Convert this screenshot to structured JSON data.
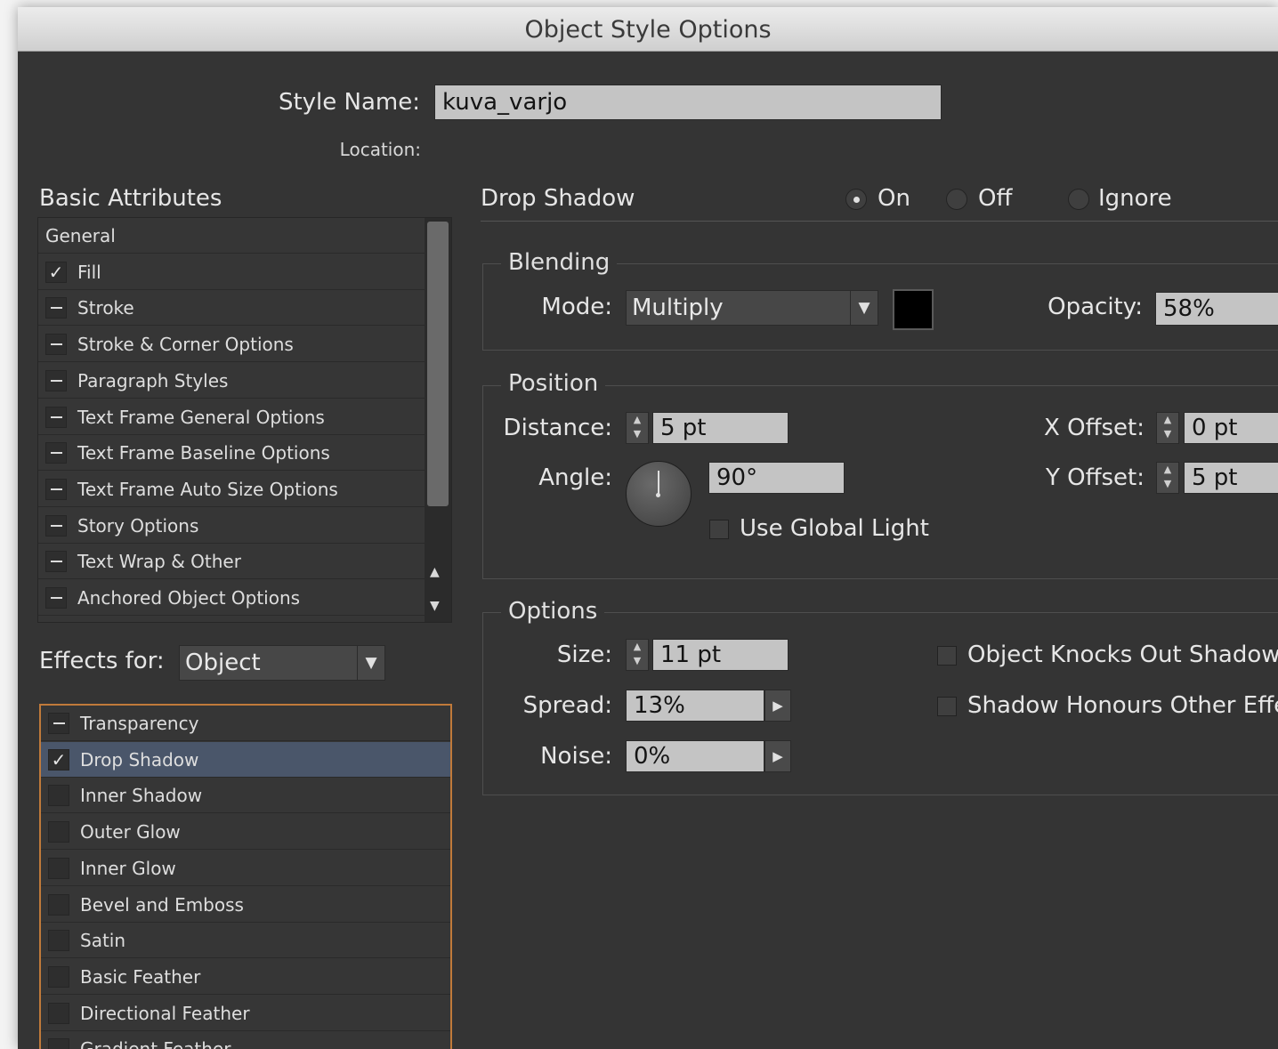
{
  "window": {
    "title": "Object Style Options"
  },
  "style_name": {
    "label": "Style Name:",
    "value": "kuva_varjo"
  },
  "location": {
    "label": "Location:"
  },
  "basic_attributes": {
    "heading": "Basic Attributes",
    "items": [
      {
        "label": "General",
        "state": "none"
      },
      {
        "label": "Fill",
        "state": "checked"
      },
      {
        "label": "Stroke",
        "state": "ignore"
      },
      {
        "label": "Stroke & Corner Options",
        "state": "ignore"
      },
      {
        "label": "Paragraph Styles",
        "state": "ignore"
      },
      {
        "label": "Text Frame General Options",
        "state": "ignore"
      },
      {
        "label": "Text Frame Baseline Options",
        "state": "ignore"
      },
      {
        "label": "Text Frame Auto Size Options",
        "state": "ignore"
      },
      {
        "label": "Story Options",
        "state": "ignore"
      },
      {
        "label": "Text Wrap & Other",
        "state": "ignore"
      },
      {
        "label": "Anchored Object Options",
        "state": "ignore"
      }
    ]
  },
  "effects_for": {
    "label": "Effects for:",
    "value": "Object"
  },
  "effects_list": {
    "items": [
      {
        "label": "Transparency",
        "state": "ignore",
        "selected": false
      },
      {
        "label": "Drop Shadow",
        "state": "checked",
        "selected": true
      },
      {
        "label": "Inner Shadow",
        "state": "unchecked",
        "selected": false
      },
      {
        "label": "Outer Glow",
        "state": "unchecked",
        "selected": false
      },
      {
        "label": "Inner Glow",
        "state": "unchecked",
        "selected": false
      },
      {
        "label": "Bevel and Emboss",
        "state": "unchecked",
        "selected": false
      },
      {
        "label": "Satin",
        "state": "unchecked",
        "selected": false
      },
      {
        "label": "Basic Feather",
        "state": "unchecked",
        "selected": false
      },
      {
        "label": "Directional Feather",
        "state": "unchecked",
        "selected": false
      },
      {
        "label": "Gradient Feather",
        "state": "unchecked",
        "selected": false
      }
    ]
  },
  "drop_shadow": {
    "heading": "Drop Shadow",
    "radios": {
      "on": "On",
      "off": "Off",
      "ignore": "Ignore",
      "selected": "on"
    },
    "blending": {
      "title": "Blending",
      "mode_label": "Mode:",
      "mode_value": "Multiply",
      "color": "#000000",
      "opacity_label": "Opacity:",
      "opacity_value": "58%"
    },
    "position": {
      "title": "Position",
      "distance_label": "Distance:",
      "distance_value": "5 pt",
      "angle_label": "Angle:",
      "angle_value": "90°",
      "use_global_light": "Use Global Light",
      "x_offset_label": "X Offset:",
      "x_offset_value": "0 pt",
      "y_offset_label": "Y Offset:",
      "y_offset_value": "5 pt"
    },
    "options": {
      "title": "Options",
      "size_label": "Size:",
      "size_value": "11 pt",
      "spread_label": "Spread:",
      "spread_value": "13%",
      "noise_label": "Noise:",
      "noise_value": "0%",
      "knocks_out": "Object Knocks Out Shadow",
      "honours_effects": "Shadow Honours Other Effects"
    }
  },
  "colors": {
    "selected_row": "#4a566a",
    "focus_border": "#c07a3a"
  }
}
